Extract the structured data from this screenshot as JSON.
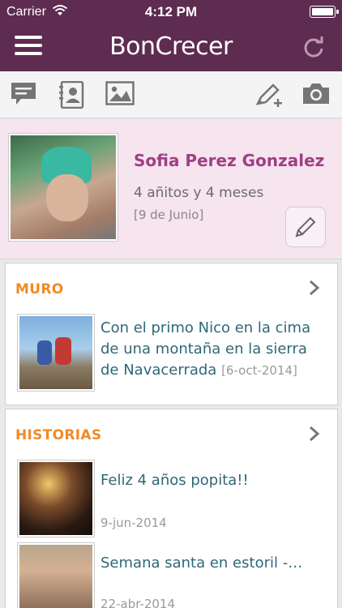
{
  "status_bar": {
    "carrier": "Carrier",
    "time": "4:12 PM"
  },
  "nav": {
    "logo_text": "BonCrecer",
    "icons": [
      "menu-icon",
      "refresh-icon"
    ]
  },
  "toolbar": {
    "icons": [
      "chat-icon",
      "contacts-icon",
      "image-icon",
      "compose-icon",
      "camera-icon"
    ]
  },
  "profile": {
    "name": "Sofia Perez Gonzalez",
    "age": "4 añitos y 4 meses",
    "birthday": "[9 de Junio]",
    "edit_icon": "pencil-icon"
  },
  "muro": {
    "title": "MURO",
    "item": {
      "text": "Con el primo Nico en la cima de una montaña en la sierra de Navacerrada",
      "date": "[6-oct-2014]"
    }
  },
  "historias": {
    "title": "HISTORIAS",
    "items": [
      {
        "title": "Feliz 4 años popita!!",
        "date": "9-jun-2014"
      },
      {
        "title": "Semana santa en estoril -…",
        "date": "22-abr-2014"
      }
    ]
  },
  "colors": {
    "nav_bg": "#5e2c50",
    "profile_bg": "#f6e4ef",
    "name": "#a03f86",
    "section_title": "#f08a26",
    "link_text": "#2f6778"
  }
}
